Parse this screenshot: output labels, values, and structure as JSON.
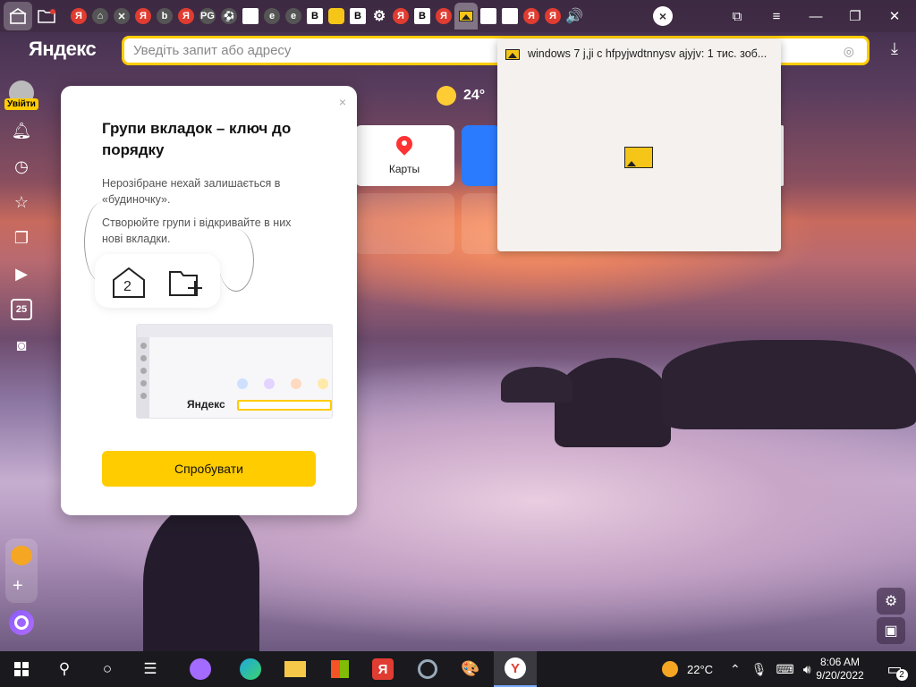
{
  "browser": {
    "brand": "Яндекс",
    "omnibox": {
      "placeholder": "Уведіть запит або адресу",
      "value": ""
    },
    "tab_preview": {
      "title": "windows 7 j,ji c hfpyjwdtnnysv ajyjv: 1 тис. зоб..."
    },
    "tabs": [
      {
        "icon": "yandex-icon",
        "letter": "Я"
      },
      {
        "icon": "gamepad-icon",
        "letter": "⌂"
      },
      {
        "icon": "puzzle-icon",
        "letter": "✕"
      },
      {
        "icon": "yandex-icon",
        "letter": "Я"
      },
      {
        "icon": "orange-icon",
        "letter": "b"
      },
      {
        "icon": "yandex-icon",
        "letter": "Я"
      },
      {
        "icon": "pg-icon",
        "letter": "PG"
      },
      {
        "icon": "soccer-icon",
        "letter": "⚽"
      },
      {
        "icon": "document-icon",
        "letter": ""
      },
      {
        "icon": "edge-icon",
        "letter": "e"
      },
      {
        "icon": "edge-icon",
        "letter": "e"
      },
      {
        "icon": "b-icon",
        "letter": "B"
      },
      {
        "icon": "image-icon",
        "letter": ""
      },
      {
        "icon": "b-icon",
        "letter": "B"
      },
      {
        "icon": "gear-icon",
        "letter": "⚙"
      },
      {
        "icon": "yandex-icon",
        "letter": "Я"
      },
      {
        "icon": "b-icon",
        "letter": "B"
      },
      {
        "icon": "yandex-icon",
        "letter": "Я"
      }
    ],
    "tabs_after": [
      {
        "icon": "document-icon",
        "letter": ""
      },
      {
        "icon": "document-icon",
        "letter": ""
      },
      {
        "icon": "yandex-icon",
        "letter": "Я"
      },
      {
        "icon": "yandex-icon",
        "letter": "Я"
      },
      {
        "icon": "speaker-icon",
        "letter": "🔊"
      }
    ]
  },
  "sidebar": {
    "login_label": "Увійти",
    "calendar_day": "25"
  },
  "newtab": {
    "weather_temp": "24°",
    "tiles": [
      {
        "label": "Карты"
      }
    ]
  },
  "promo": {
    "title": "Групи вкладок – ключ до порядку",
    "paragraph1": "Нерозібране нехай залишається в «будиночку».",
    "paragraph2": "Створюйте групи і відкривайте в них нові вкладки.",
    "group_count": "2",
    "mock_brand": "Яндекс",
    "button_label": "Спробувати",
    "close_label": "×"
  },
  "taskbar": {
    "weather": "22°C",
    "time": "8:06 AM",
    "date": "9/20/2022",
    "notifications": "2"
  },
  "colors": {
    "accent": "#ffcc00",
    "yandex_red": "#e03c31"
  }
}
